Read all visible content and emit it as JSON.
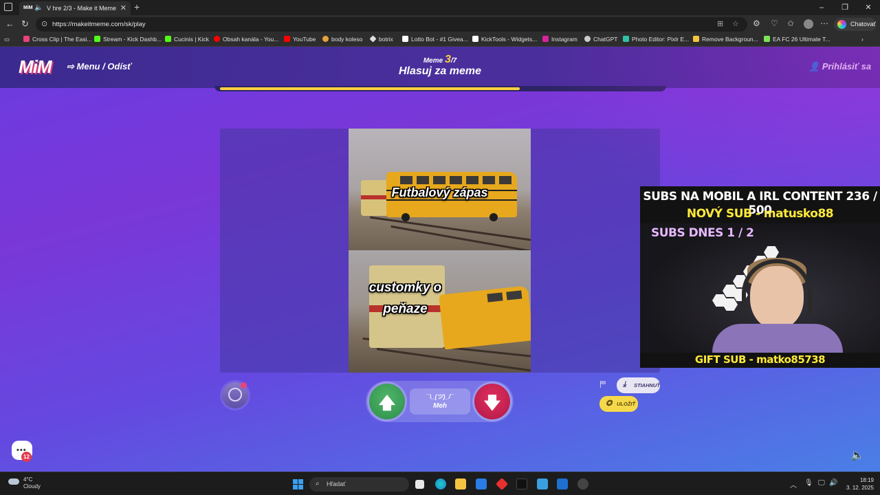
{
  "browser": {
    "tab_title": "V hre 2/3 - Make it Meme",
    "url": "https://makeitmeme.com/sk/play",
    "chat_button": "Chatovať"
  },
  "bookmarks": [
    {
      "label": "Cross Clip | The Easi...",
      "color": "#e8437a"
    },
    {
      "label": "Stream - Kick Dashb...",
      "color": "#53fc18"
    },
    {
      "label": "Cucinis | Kick",
      "color": "#53fc18"
    },
    {
      "label": "Obsah kanála - You...",
      "color": "#ff0000"
    },
    {
      "label": "YouTube",
      "color": "#ff0000"
    },
    {
      "label": "body koleso",
      "color": "#e8a23b"
    },
    {
      "label": "botrix",
      "color": "#dddddd"
    },
    {
      "label": "Lotto Bot - #1 Givea...",
      "color": "#ffffff"
    },
    {
      "label": "KickTools - Widgets...",
      "color": "#ffffff"
    },
    {
      "label": "Instagram",
      "color": "#d6249f"
    },
    {
      "label": "ChatGPT",
      "color": "#cccccc"
    },
    {
      "label": "Photo Editor: Pixlr E...",
      "color": "#2fc2a8"
    },
    {
      "label": "Remove Backgroun...",
      "color": "#f5c542"
    },
    {
      "label": "EA FC 26 Ultimate T...",
      "color": "#7be35a"
    }
  ],
  "site": {
    "logo": "MiM",
    "menu_link": "Menu / Odísť",
    "round_prefix": "Meme ",
    "round_current": "3",
    "round_total": "/7",
    "title": "Hlasuj za meme",
    "login": "Prihlásiť sa",
    "progress_fraction": 0.68
  },
  "meme": {
    "caption_top": "Futbalový zápas",
    "caption_bottom_1": "customky o",
    "caption_bottom_2": "peňaze"
  },
  "vote": {
    "up_icon": "arrow-up-icon",
    "down_icon": "arrow-down-icon",
    "meh_shrug": "¯\\_(ツ)_/¯",
    "meh_label": "Meh"
  },
  "actions": {
    "download": "STIAHNUŤ",
    "save": "ULOŽIŤ"
  },
  "chat": {
    "badge_count": "12"
  },
  "stream_overlay": {
    "line1": "SUBS NA MOBIL A IRL CONTENT  236 / 500",
    "line2": "NOVÝ SUB - matusko88",
    "line3": "SUBS DNES  1 / 2",
    "line4": "GIFT SUB - matko85738"
  },
  "taskbar": {
    "temp": "4°C",
    "weather": "Cloudy",
    "search_placeholder": "Hľadať",
    "time": "18:19",
    "date": "3. 12. 2025"
  }
}
